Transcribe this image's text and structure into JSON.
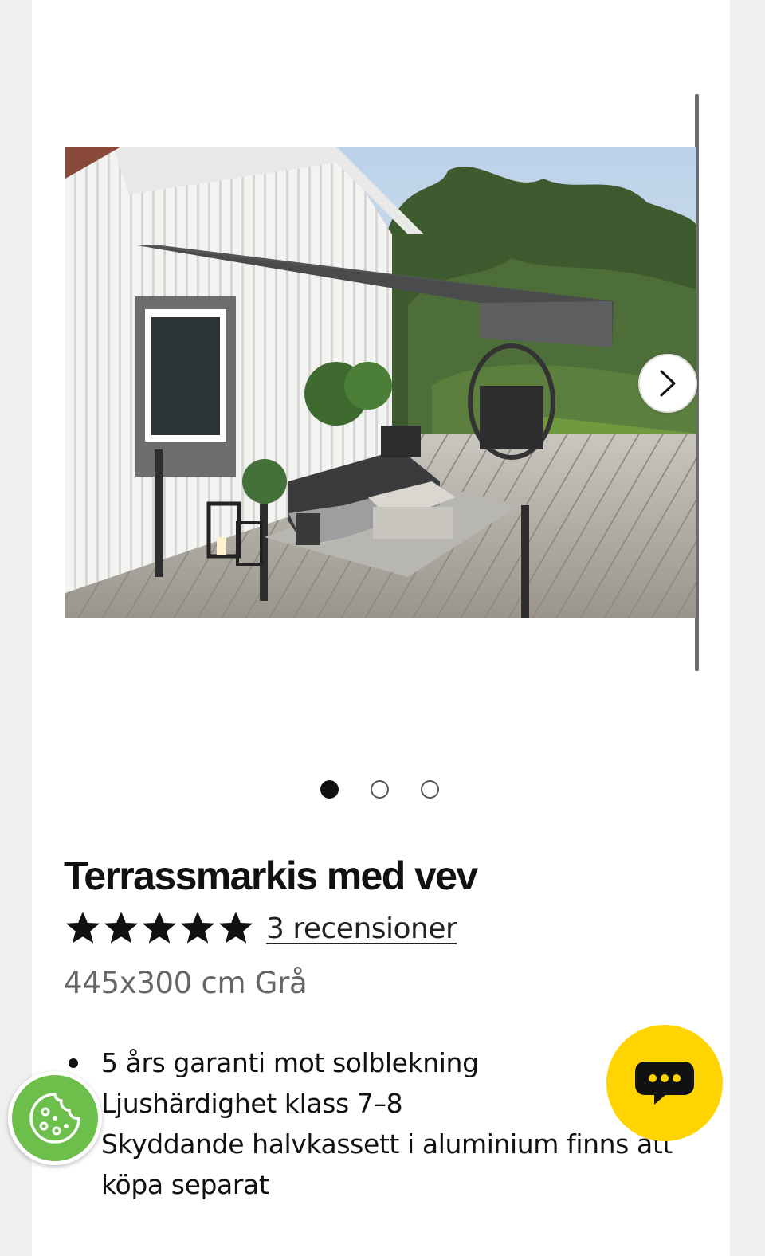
{
  "product": {
    "title": "Terrassmarkis med vev",
    "rating": 5,
    "max_rating": 5,
    "reviews_label": "3 recensioner",
    "variant": "445x300 cm Grå",
    "features": [
      "5 års garanti mot solblekning",
      "Ljushärdighet klass 7–8",
      "Skyddande halvkassett i aluminium finns att köpa separat"
    ]
  },
  "gallery": {
    "image_count": 3,
    "active_index": 0,
    "image_alt": "Grå markis över trädäck med utemöbler"
  },
  "colors": {
    "accent_chat": "#ffd400",
    "cookie": "#6bbf4a",
    "text": "#111111",
    "muted": "#666666"
  },
  "icons": {
    "next": "chevron-right-icon",
    "star": "star-icon",
    "cookie": "cookie-icon",
    "chat": "chat-bubble-icon"
  }
}
